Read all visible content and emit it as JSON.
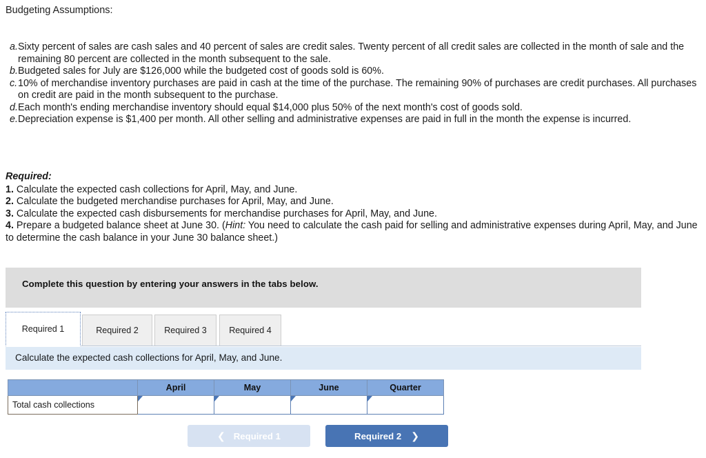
{
  "intro": {
    "heading": "Budgeting Assumptions:"
  },
  "assumptions": [
    {
      "marker": "a.",
      "text": "Sixty percent of sales are cash sales and 40 percent of sales are credit sales. Twenty percent of all credit sales are collected in the month of sale and the remaining 80 percent are collected in the month subsequent to the sale."
    },
    {
      "marker": "b.",
      "text": "Budgeted sales for July are $126,000 while the budgeted cost of goods sold is 60%."
    },
    {
      "marker": "c.",
      "text": "10% of merchandise inventory purchases are paid in cash at the time of the purchase. The remaining 90% of purchases are credit purchases. All purchases on credit are paid in the month subsequent to the purchase."
    },
    {
      "marker": "d.",
      "text": "Each month's ending merchandise inventory should equal $14,000 plus 50% of the next month's cost of goods sold."
    },
    {
      "marker": "e.",
      "text": "Depreciation expense is $1,400 per month. All other selling and administrative expenses are paid in full in the month the expense is incurred."
    }
  ],
  "required": {
    "title": "Required:",
    "items": [
      {
        "num": "1.",
        "text": "Calculate the expected cash collections for April, May, and June."
      },
      {
        "num": "2.",
        "text": "Calculate the budgeted merchandise purchases for April, May, and June."
      },
      {
        "num": "3.",
        "text": "Calculate the expected cash disbursements for merchandise purchases for April, May, and June."
      },
      {
        "num": "4.",
        "text": "Prepare a budgeted balance sheet at June 30. (",
        "hint_label": "Hint:",
        "text_after": " You need to calculate the cash paid for selling and administrative expenses during April, May, and June to determine the cash balance in your June 30 balance sheet.)"
      }
    ]
  },
  "instruction_bar": {
    "text": "Complete this question by entering your answers in the tabs below."
  },
  "tabs": [
    {
      "label": "Required 1",
      "active": true
    },
    {
      "label": "Required 2",
      "active": false
    },
    {
      "label": "Required 3",
      "active": false
    },
    {
      "label": "Required 4",
      "active": false
    }
  ],
  "tab_instruction": {
    "text": "Calculate the expected cash collections for April, May, and June."
  },
  "answer_table": {
    "headers": [
      "",
      "April",
      "May",
      "June",
      "Quarter"
    ],
    "rows": [
      {
        "label": "Total cash collections",
        "values": [
          "",
          "",
          "",
          ""
        ]
      }
    ]
  },
  "nav": {
    "prev_label": "Required 1",
    "prev_icon": "chevron-left-icon",
    "next_label": "Required 2",
    "next_icon": "chevron-right-icon"
  },
  "colors": {
    "gray_bar": "#dddddd",
    "blue_bar": "#deeaf6",
    "table_header": "#85aade",
    "next_button": "#4874b4",
    "prev_button": "#d7e2f2",
    "input_border": "#5c7fb3",
    "focus_outline": "#5a7fba"
  }
}
